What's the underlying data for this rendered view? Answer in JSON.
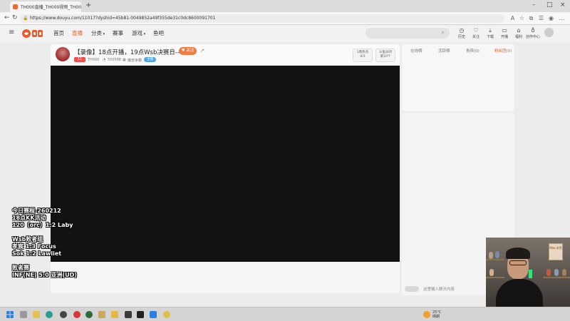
{
  "browser": {
    "tab_title": "TH000直播_TH000视频_TH000图片",
    "url": "https://www.douyu.com/11017?dyshid=45b81-0049852a49f355de31c0dc8600091701"
  },
  "site": {
    "logo_text": "斗鱼",
    "nav": [
      {
        "label": "首页"
      },
      {
        "label": "直播"
      },
      {
        "label": "分类"
      },
      {
        "label": "赛事"
      },
      {
        "label": "游戏"
      },
      {
        "label": "鱼吧"
      }
    ],
    "header_icons": [
      {
        "label": "历史"
      },
      {
        "label": "关注"
      },
      {
        "label": "下载"
      },
      {
        "label": "开播"
      },
      {
        "label": "福利"
      },
      {
        "label": "创作中心"
      }
    ]
  },
  "stream": {
    "title": "【录像】18点开播，19点Wsb决赛日--",
    "follow_label": "关注",
    "level": "11",
    "name": "TH000",
    "viewers": "550588",
    "category": "魔兽争霸",
    "tag": "主播",
    "rank1_line1": "1周热点",
    "rank1_line2": "0/3",
    "rank2_line1": "斗鱼派对",
    "rank2_line2": "第10个"
  },
  "right_panel": {
    "tabs": [
      {
        "label": "在线榜"
      },
      {
        "label": "活跃榜"
      },
      {
        "label": "贵宾(0)"
      },
      {
        "label": "粉丝团(0)"
      }
    ],
    "chat_placeholder": "这里输入聊天内容"
  },
  "overlay": {
    "lines": [
      "今日赛程-260212",
      "18点KK活动",
      "120（orc）1:2 Laby",
      "",
      "Wsb败者组",
      "孝宸  1:3 Focus",
      "Sok  1:2 Lawliet",
      "",
      "败者赛",
      "INF(NE) 5:0 亚洲(UD)"
    ]
  },
  "webcam": {
    "poster_text": "Mao 本色"
  },
  "taskbar": {
    "temperature": "25°C",
    "weather": "晴朗"
  }
}
